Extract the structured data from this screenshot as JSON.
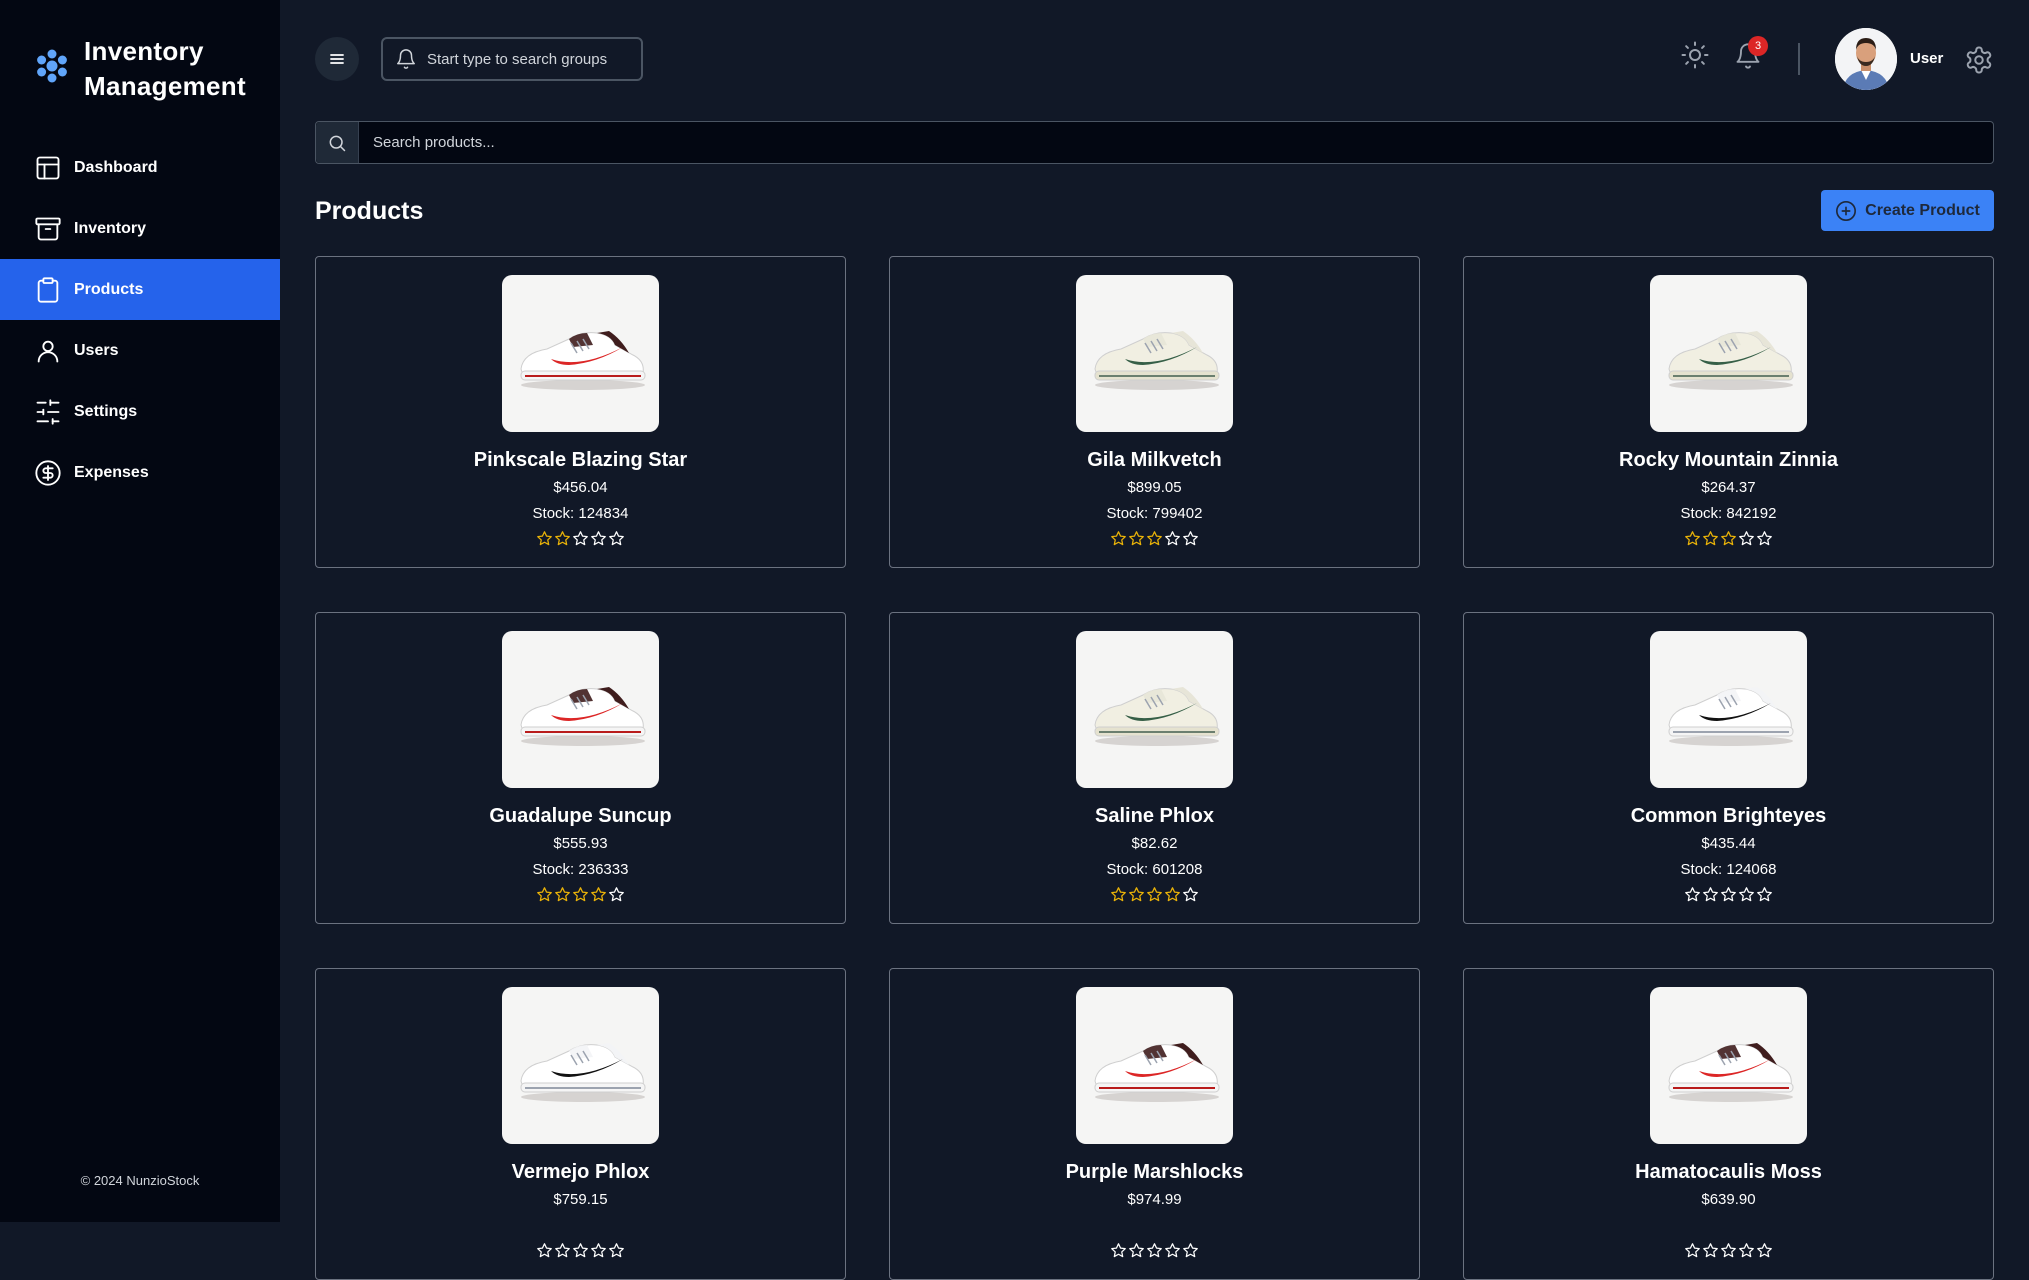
{
  "brand": {
    "line1": "Inventory",
    "line2": "Management"
  },
  "sidebar": {
    "items": [
      {
        "label": "Dashboard",
        "icon": "layout-icon",
        "active": false
      },
      {
        "label": "Inventory",
        "icon": "archive-icon",
        "active": false
      },
      {
        "label": "Products",
        "icon": "clipboard-icon",
        "active": true
      },
      {
        "label": "Users",
        "icon": "user-icon",
        "active": false
      },
      {
        "label": "Settings",
        "icon": "sliders-icon",
        "active": false
      },
      {
        "label": "Expenses",
        "icon": "dollar-circle-icon",
        "active": false
      }
    ],
    "copyright": "© 2024 NunzioStock"
  },
  "topbar": {
    "group_search_placeholder": "Start type to search groups",
    "notification_count": "3",
    "user_name": "User"
  },
  "search": {
    "placeholder": "Search products..."
  },
  "page": {
    "title": "Products",
    "create_label": "Create Product"
  },
  "colors": {
    "accent": "#2563eb",
    "button": "#3b82f6",
    "star": "#eab308",
    "background": "#111827",
    "sidebar": "#030712"
  },
  "products": [
    {
      "name": "Pinkscale Blazing Star",
      "price": "$456.04",
      "stock": "Stock: 124834",
      "rating": 2,
      "shoe": "red"
    },
    {
      "name": "Gila Milkvetch",
      "price": "$899.05",
      "stock": "Stock: 799402",
      "rating": 3,
      "shoe": "green"
    },
    {
      "name": "Rocky Mountain Zinnia",
      "price": "$264.37",
      "stock": "Stock: 842192",
      "rating": 3,
      "shoe": "green"
    },
    {
      "name": "Guadalupe Suncup",
      "price": "$555.93",
      "stock": "Stock: 236333",
      "rating": 4,
      "shoe": "red"
    },
    {
      "name": "Saline Phlox",
      "price": "$82.62",
      "stock": "Stock: 601208",
      "rating": 4,
      "shoe": "green"
    },
    {
      "name": "Common Brighteyes",
      "price": "$435.44",
      "stock": "Stock: 124068",
      "rating": 0,
      "shoe": "black"
    },
    {
      "name": "Vermejo Phlox",
      "price": "$759.15",
      "stock": "",
      "rating": 0,
      "shoe": "black"
    },
    {
      "name": "Purple Marshlocks",
      "price": "$974.99",
      "stock": "",
      "rating": 0,
      "shoe": "red"
    },
    {
      "name": "Hamatocaulis Moss",
      "price": "$639.90",
      "stock": "",
      "rating": 0,
      "shoe": "red"
    }
  ]
}
